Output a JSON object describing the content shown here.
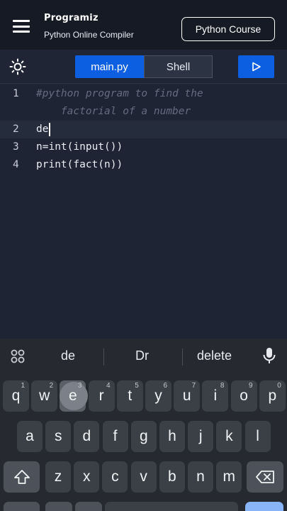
{
  "header": {
    "brand_name": "Programiz",
    "brand_sub": "Python Online Compiler",
    "course_button": "Python Course"
  },
  "toolbar": {
    "tab_main": "main.py",
    "tab_shell": "Shell",
    "run_icon": "play-icon",
    "theme_icon": "sun-icon"
  },
  "editor": {
    "lines": [
      {
        "num": "1",
        "text": "#python program to find the"
      },
      {
        "num": "",
        "text": "    factorial of a number"
      },
      {
        "num": "2",
        "text": "de"
      },
      {
        "num": "3",
        "text": "n=int(input())"
      },
      {
        "num": "4",
        "text": "print(fact(n))"
      }
    ]
  },
  "keyboard": {
    "suggestions": [
      "de",
      "Dr",
      "delete"
    ],
    "row1": [
      {
        "k": "q",
        "h": "1"
      },
      {
        "k": "w",
        "h": "2"
      },
      {
        "k": "e",
        "h": "3"
      },
      {
        "k": "r",
        "h": "4"
      },
      {
        "k": "t",
        "h": "5"
      },
      {
        "k": "y",
        "h": "6"
      },
      {
        "k": "u",
        "h": "7"
      },
      {
        "k": "i",
        "h": "8"
      },
      {
        "k": "o",
        "h": "9"
      },
      {
        "k": "p",
        "h": "0"
      }
    ],
    "row2": [
      "a",
      "s",
      "d",
      "f",
      "g",
      "h",
      "j",
      "k",
      "l"
    ],
    "row3": [
      "z",
      "x",
      "c",
      "v",
      "b",
      "n",
      "m"
    ],
    "shift_icon": "shift-icon",
    "backspace_icon": "backspace-icon"
  },
  "colors": {
    "accent": "#0b5fe0",
    "editor_bg": "#1e2433",
    "header_bg": "#161a24",
    "keyboard_bg": "#262a30"
  }
}
